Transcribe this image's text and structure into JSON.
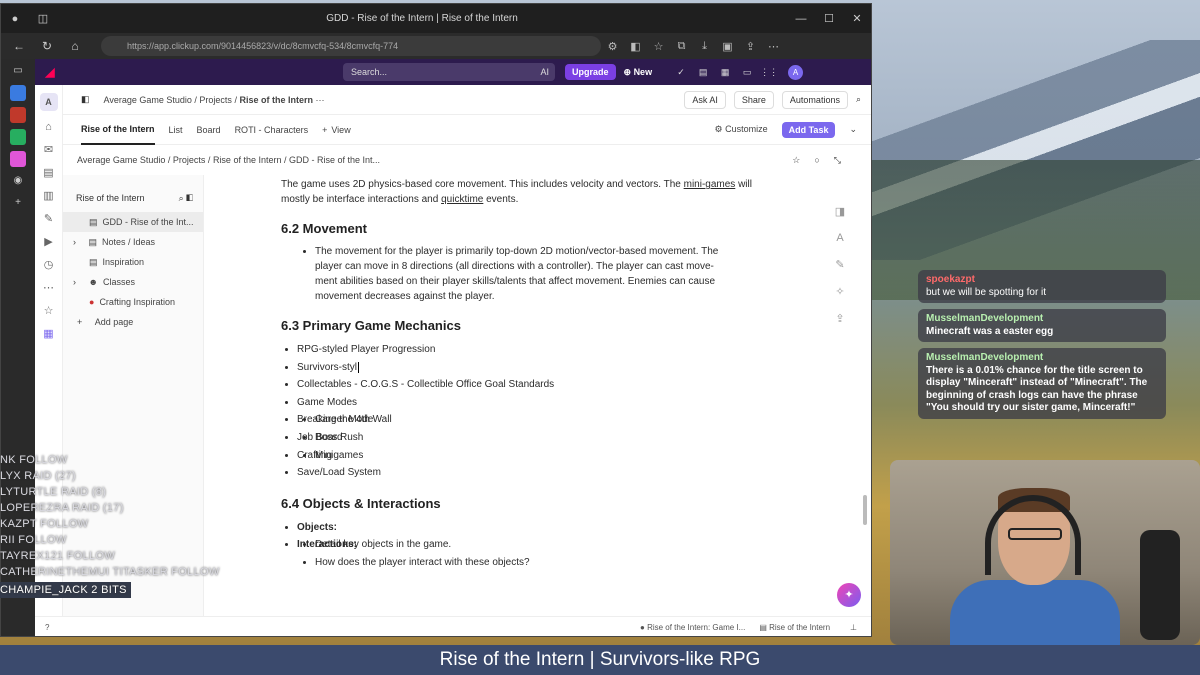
{
  "browser": {
    "tab_title": "GDD - Rise of the Intern | Rise of the Intern",
    "url": "https://app.clickup.com/9014456823/v/dc/8cmvcfq-534/8cmvcfq-774"
  },
  "topbar": {
    "search_placeholder": "Search...",
    "ai_label": "AI",
    "upgrade_label": "Upgrade",
    "new_label": "New",
    "avatar_letter": "A"
  },
  "header1": {
    "workspace_badge": "A",
    "crumbs": [
      "Average Game Studio",
      "Projects",
      "Rise of the Intern"
    ],
    "more": "···",
    "ask_ai": "Ask AI",
    "share": "Share",
    "automations": "Automations"
  },
  "header2": {
    "tabs": [
      "Rise of the Intern",
      "List",
      "Board",
      "ROTI - Characters"
    ],
    "add_view": "View",
    "customize": "Customize",
    "add_task": "Add Task"
  },
  "header3": {
    "crumbs": [
      "Average Game Studio",
      "Projects",
      "Rise of the Intern",
      "GDD - Rise of the Int..."
    ]
  },
  "sidebar": {
    "title": "Rise of the Intern",
    "items": [
      "GDD - Rise of the Int...",
      "Notes / Ideas",
      "Inspiration",
      "Classes",
      "Crafting Inspiration"
    ],
    "add_page": "Add page"
  },
  "doc": {
    "intro_a": "The game uses 2D physics-based core movement. This includes velocity and vectors. The ",
    "intro_link1": "mini-games",
    "intro_b": " will mostly be interface interactions and ",
    "intro_link2": "quicktime",
    "intro_c": " events.",
    "h_movement": "6.2 Movement",
    "movement_line1": "The movement for the player is primarily top-down 2D motion/vector-based movement. The",
    "movement_line2": "player can move in 8 directions (all directions with a controller). The player can cast move-",
    "movement_line3": "ment abilities based on their player skills/talents that affect movement. Enemies can cause",
    "movement_line4": "movement decreases against the player.",
    "h_mechanics": "6.3 Primary Game Mechanics",
    "mechanics": [
      "RPG-styled Player Progression",
      "Survivors-styl",
      "Collectables - C.O.G.S - Collectible Office Goal Standards",
      "Game Modes"
    ],
    "modes": [
      "Career Mode",
      "Boss Rush",
      "Minigames"
    ],
    "mechanics2": [
      "Breaking the 4th Wall",
      "Job Board",
      "Crafting",
      "Save/Load System"
    ],
    "h_objects": "6.4 Objects & Interactions",
    "objects_label": "Objects:",
    "objects_item": "Detail key objects in the game.",
    "interactions_label": "Interactions:",
    "interactions_item": "How does the player interact with these objects?"
  },
  "bottombar": {
    "links": [
      "Rise of the Intern: Game I...",
      "Rise of the Intern"
    ]
  },
  "stream": {
    "caption": "Rise of the Intern | Survivors-like RPG",
    "events": [
      "NK  FOLLOW",
      "LYX  RAID (27)",
      "LYTURTLE  RAID (8)",
      "LOPEREZRA  RAID (17)",
      "KAZPT  FOLLOW",
      "RII  FOLLOW",
      "TAYREX121  FOLLOW",
      "CATHERINETHEMUI TITASKER  FOLLOW",
      "CHAMPIE_JACK  2 BITS"
    ],
    "chat": [
      {
        "user": "spoekazpt",
        "text": "but we will be spotting for it"
      },
      {
        "user": "MusselmanDevelopment",
        "text": "Minecraft was a easter egg"
      },
      {
        "user": "MusselmanDevelopment",
        "text": "There is a 0.01% chance for the title screen to display \"Minceraft\" instead of \"Minecraft\". The beginning of crash logs can have the phrase \"You should try our sister game, Minceraft!\""
      }
    ]
  },
  "colors": {
    "clickup_top": "#2d1b4e",
    "accent": "#7b68ee",
    "upgrade": "#7b3fe4"
  }
}
